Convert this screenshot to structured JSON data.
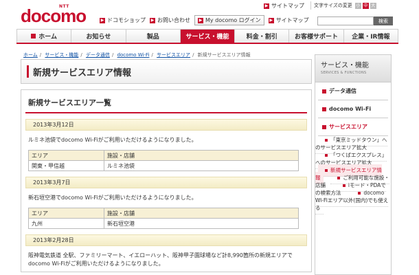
{
  "header": {
    "logo_small": "NTT",
    "logo_text": "docomo",
    "util_links": [
      "ドコモショップ",
      "お問い合わせ",
      "My docomo ログイン",
      "サイトマップ"
    ],
    "sitemap_top": "サイトマップ",
    "font_size_label": "文字サイズの変更",
    "font_sizes": [
      "小",
      "中",
      "大"
    ],
    "search_placeholder": "",
    "search_button": "検索"
  },
  "gnav": [
    "ホーム",
    "お知らせ",
    "製品",
    "サービス・機能",
    "料金・割引",
    "お客様サポート",
    "企業・IR情報"
  ],
  "breadcrumb": [
    "ホーム",
    "サービス・機能",
    "データ通信",
    "docomo Wi-Fi",
    "サービスエリア",
    "新規サービスエリア情報"
  ],
  "page_title": "新規サービスエリア情報",
  "section_title": "新規サービスエリア一覧",
  "notices": [
    {
      "date": "2013年3月12日",
      "text": "ルミネ池袋でdocomo Wi-Fiがご利用いただけるようになりました。",
      "table": {
        "headers": [
          "エリア",
          "施設・店舗"
        ],
        "rows": [
          [
            "関東・甲信越",
            "ルミネ池袋"
          ]
        ]
      }
    },
    {
      "date": "2013年3月7日",
      "text": "新石垣空港でdocomo Wi-Fiがご利用いただけるようになりました。",
      "table": {
        "headers": [
          "エリア",
          "施設・店舗"
        ],
        "rows": [
          [
            "九州",
            "新石垣空港"
          ]
        ]
      }
    },
    {
      "date": "2013年2月28日",
      "text": "阪神電気鉄道 全駅、ファミリーマート、イエローハット、阪神甲子園球場など計8,990箇所の新規エリアでdocomo Wi-Fiがご利用いただけるようになりました。"
    }
  ],
  "side": {
    "title": "サービス・機能",
    "subtitle": "SERVICES & FUNCTIONS",
    "items": [
      "データ通信",
      "docomo Wi-Fi",
      "サービスエリア"
    ],
    "sub_items": [
      "「東京ミッドタウン」へのサービスエリア拡大",
      "「つくばエクスプレス」へのサービスエリア拡大",
      "新規サービスエリア情報",
      "ご利用可能な施設・店舗",
      "iモード・PDAでの検索方法",
      "docomo Wi-Fiエリア以外(国内)でも使える"
    ]
  },
  "colors": {
    "brand": "#c8102e",
    "date_bar": "#f3ecc6",
    "link": "#0b4ea2"
  }
}
